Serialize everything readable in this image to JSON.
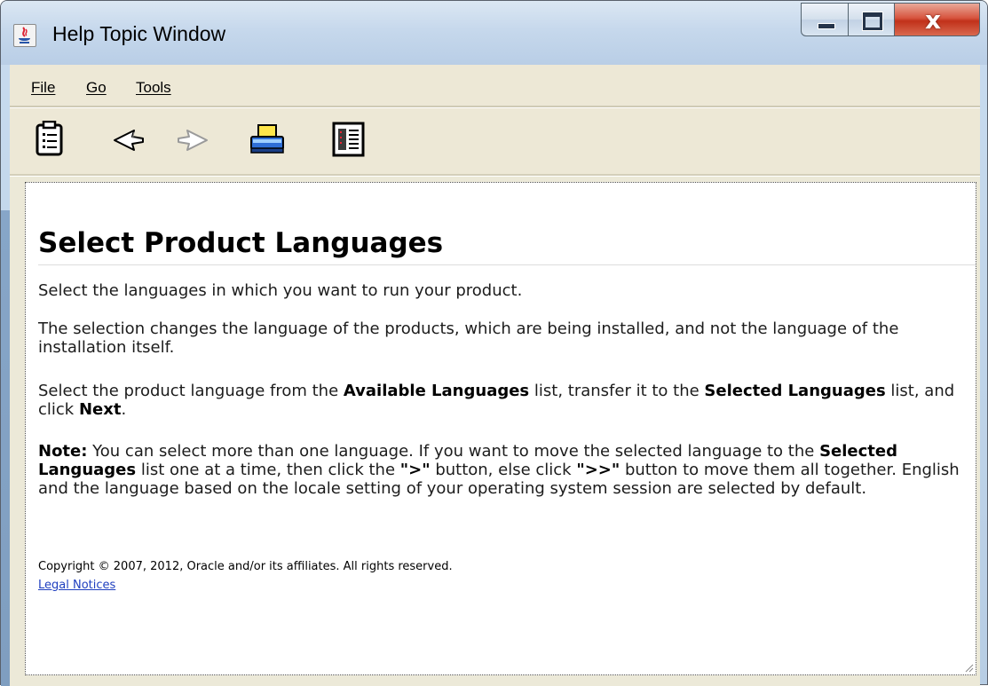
{
  "window": {
    "title": "Help Topic Window",
    "controls": {
      "minimize": "minimize-icon",
      "maximize": "maximize-icon",
      "close": "close-icon"
    }
  },
  "menu": [
    {
      "label": "File"
    },
    {
      "label": "Go"
    },
    {
      "label": "Tools"
    }
  ],
  "toolbar": [
    {
      "name": "toc-button",
      "icon": "clipboard-list-icon"
    },
    {
      "name": "back-button",
      "icon": "back-arrow-icon"
    },
    {
      "name": "forward-button",
      "icon": "forward-arrow-icon"
    },
    {
      "name": "print-button",
      "icon": "printer-icon"
    },
    {
      "name": "page-setup-button",
      "icon": "page-layout-icon"
    }
  ],
  "content": {
    "heading": "Select Product Languages",
    "p1": "Select the languages in which you want to run your product.",
    "p2": "The selection changes the language of the products, which are being installed, and not the language of the installation itself.",
    "p3": {
      "a": "Select the product language from the ",
      "b": "Available Languages",
      "c": " list, transfer it to the ",
      "d": "Selected Languages",
      "e": " list, and click ",
      "f": "Next",
      "g": "."
    },
    "p4": {
      "note": "Note:",
      "a": " You can select more than one language. If you want to move the selected language to the ",
      "b": "Selected Languages",
      "c": " list one at a time, then click the ",
      "d": "\">\"",
      "e": " button, else click ",
      "f": "\">>\"",
      "g": " button to move them all together. English and the language based on the locale setting of your operating system session are selected by default."
    },
    "copyright": "Copyright © 2007, 2012, Oracle and/or its affiliates. All rights reserved.",
    "legal_link": "Legal Notices"
  },
  "colors": {
    "titlebar": "#c6d8ec",
    "client_bg": "#ece9d8",
    "link": "#1f3fbf",
    "close_button": "#c1311a"
  }
}
